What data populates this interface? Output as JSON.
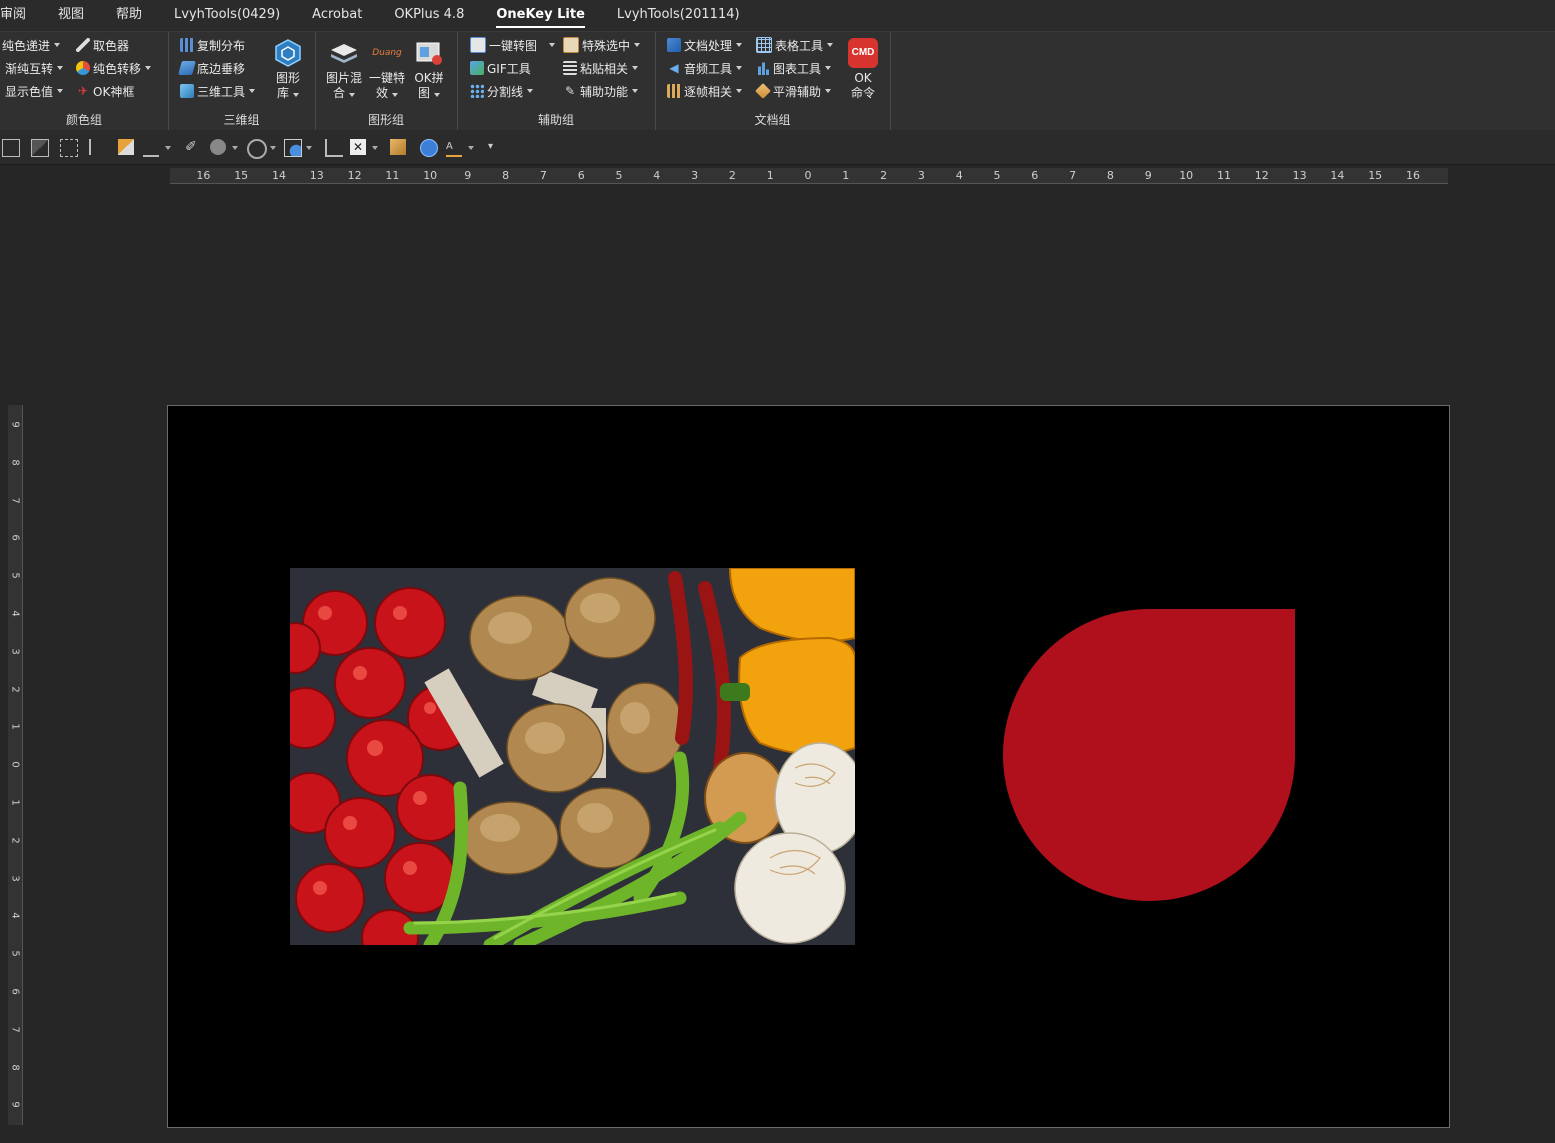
{
  "tabs": [
    "审阅",
    "视图",
    "帮助",
    "LvyhTools(0429)",
    "Acrobat",
    "OKPlus 4.8",
    "OneKey Lite",
    "LvyhTools(201114)"
  ],
  "active_tab": "OneKey Lite",
  "groups": {
    "color": {
      "label": "颜色组",
      "btn1": "纯色递进",
      "btn2": "渐纯互转",
      "btn3": "显示色值",
      "btn4": "取色器",
      "btn5": "纯色转移",
      "btn6": "OK神框"
    },
    "threed": {
      "label": "三维组",
      "btn1": "复制分布",
      "btn2": "底边垂移",
      "btn3": "三维工具",
      "big1": "图形",
      "big1b": "库"
    },
    "graphic": {
      "label": "图形组",
      "big1": "图片混",
      "big1b": "合",
      "big2": "一键特",
      "big2b": "效",
      "big3": "OK拼",
      "big3b": "图",
      "duang": "Duang"
    },
    "assist": {
      "label": "辅助组",
      "btn1": "一键转图",
      "btn2": "GIF工具",
      "btn3": "分割线",
      "btn4": "特殊选中",
      "btn5": "粘贴相关",
      "btn6": "辅助功能"
    },
    "doc": {
      "label": "文档组",
      "btn1": "文档处理",
      "btn2": "音频工具",
      "btn3": "逐帧相关",
      "btn4": "表格工具",
      "btn5": "图表工具",
      "btn6": "平滑辅助",
      "cmd_icon": "CMD",
      "big1": "OK",
      "big1b": "命令"
    }
  },
  "ruler_h": [
    "16",
    "15",
    "14",
    "13",
    "12",
    "11",
    "10",
    "9",
    "8",
    "7",
    "6",
    "5",
    "4",
    "3",
    "2",
    "1",
    "0",
    "1",
    "2",
    "3",
    "4",
    "5",
    "6",
    "7",
    "8",
    "9",
    "10",
    "11",
    "12",
    "13",
    "14",
    "15",
    "16"
  ],
  "ruler_v": [
    "9",
    "8",
    "7",
    "6",
    "5",
    "4",
    "3",
    "2",
    "1",
    "0",
    "1",
    "2",
    "3",
    "4",
    "5",
    "6",
    "7",
    "8",
    "9"
  ],
  "colors": {
    "accent_red": "#b00f1c",
    "slide_bg": "#000000"
  },
  "slide": {
    "image": "vegetables-photo",
    "shape": "teardrop-shape"
  }
}
